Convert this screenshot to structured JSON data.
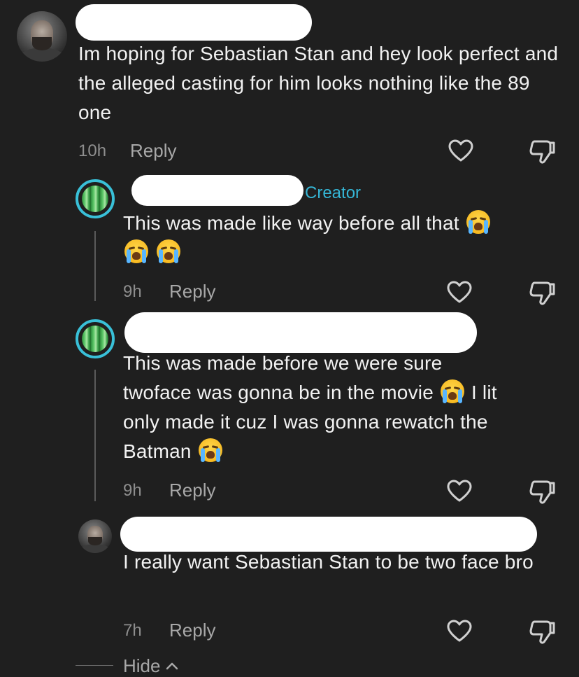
{
  "comments": [
    {
      "text": "Im hoping for Sebastian Stan and hey look perfect and the alleged casting for him looks nothing like the 89 one",
      "time": "10h",
      "reply_label": "Reply"
    },
    {
      "creator_label": "Creator",
      "text": "This was made like way before all that",
      "time": "9h",
      "reply_label": "Reply"
    },
    {
      "text_line1": "This was made before we were sure",
      "text_line2a": "twoface was gonna be in the movie",
      "text_line2b": "I lit",
      "text_line3": "only made it cuz I was gonna rewatch the",
      "text_line4": "Batman",
      "time": "9h",
      "reply_label": "Reply"
    },
    {
      "text": "I really want Sebastian Stan to be two face bro",
      "time": "7h",
      "reply_label": "Reply"
    }
  ],
  "hide_label": "Hide",
  "icons": {
    "like": "heart-outline-icon",
    "dislike": "thumbs-down-outline-icon",
    "emoji": "loudly-crying-face-emoji",
    "hide_chevron": "chevron-up-icon"
  },
  "colors": {
    "background": "#1f1f1f",
    "creator_accent": "#35b6d6"
  }
}
